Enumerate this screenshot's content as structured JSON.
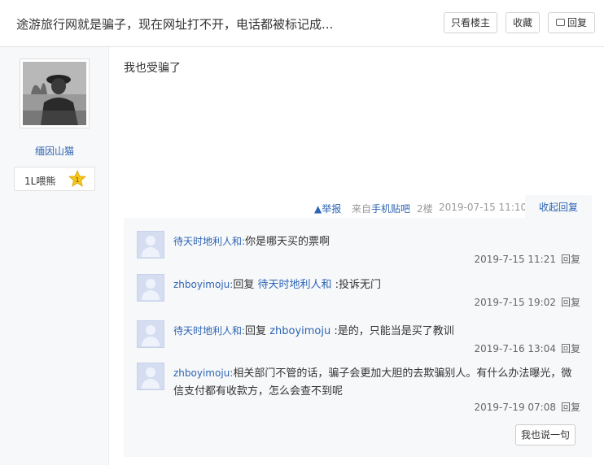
{
  "header": {
    "title": "途游旅行网就是骗子，现在网址打不开，电话都被标记成...",
    "only_op_label": "只看楼主",
    "favorite_label": "收藏",
    "reply_label": "回复"
  },
  "author": {
    "name": "缅因山猫",
    "level_text": "1L喂熊",
    "level_num": "1"
  },
  "post": {
    "content": "我也受骗了",
    "report_label": "举报",
    "source_prefix": "来自",
    "source_name": "手机贴吧",
    "floor": "2楼",
    "time": "2019-07-15 11:10",
    "collapse_label": "收起回复"
  },
  "replies": [
    {
      "user": "待天时地利人和:",
      "prefix": "",
      "target": "",
      "text": "你是哪天买的票啊",
      "time": "2019-7-15 11:21",
      "reply_label": "回复"
    },
    {
      "user": "zhboyimoju:",
      "prefix": "回复 ",
      "target": "待天时地利人和",
      "text": " :投诉无门",
      "time": "2019-7-15 19:02",
      "reply_label": "回复"
    },
    {
      "user": "待天时地利人和:",
      "prefix": "回复 ",
      "target": "zhboyimoju",
      "text": " :是的，只能当是买了教训",
      "time": "2019-7-16 13:04",
      "reply_label": "回复"
    },
    {
      "user": "zhboyimoju:",
      "prefix": "",
      "target": "",
      "text": "相关部门不管的话，骗子会更加大胆的去欺骗别人。有什么办法曝光，微信支付都有收款方，怎么会查不到呢",
      "time": "2019-7-19 07:08",
      "reply_label": "回复"
    }
  ],
  "say_button_label": "我也说一句",
  "colors": {
    "link": "#2d64b3",
    "panel": "#f7f8fa",
    "badge": "#f5c518"
  },
  "icons": {
    "report": "warning-triangle-icon",
    "reply": "comment-icon",
    "level": "star-badge-icon"
  }
}
